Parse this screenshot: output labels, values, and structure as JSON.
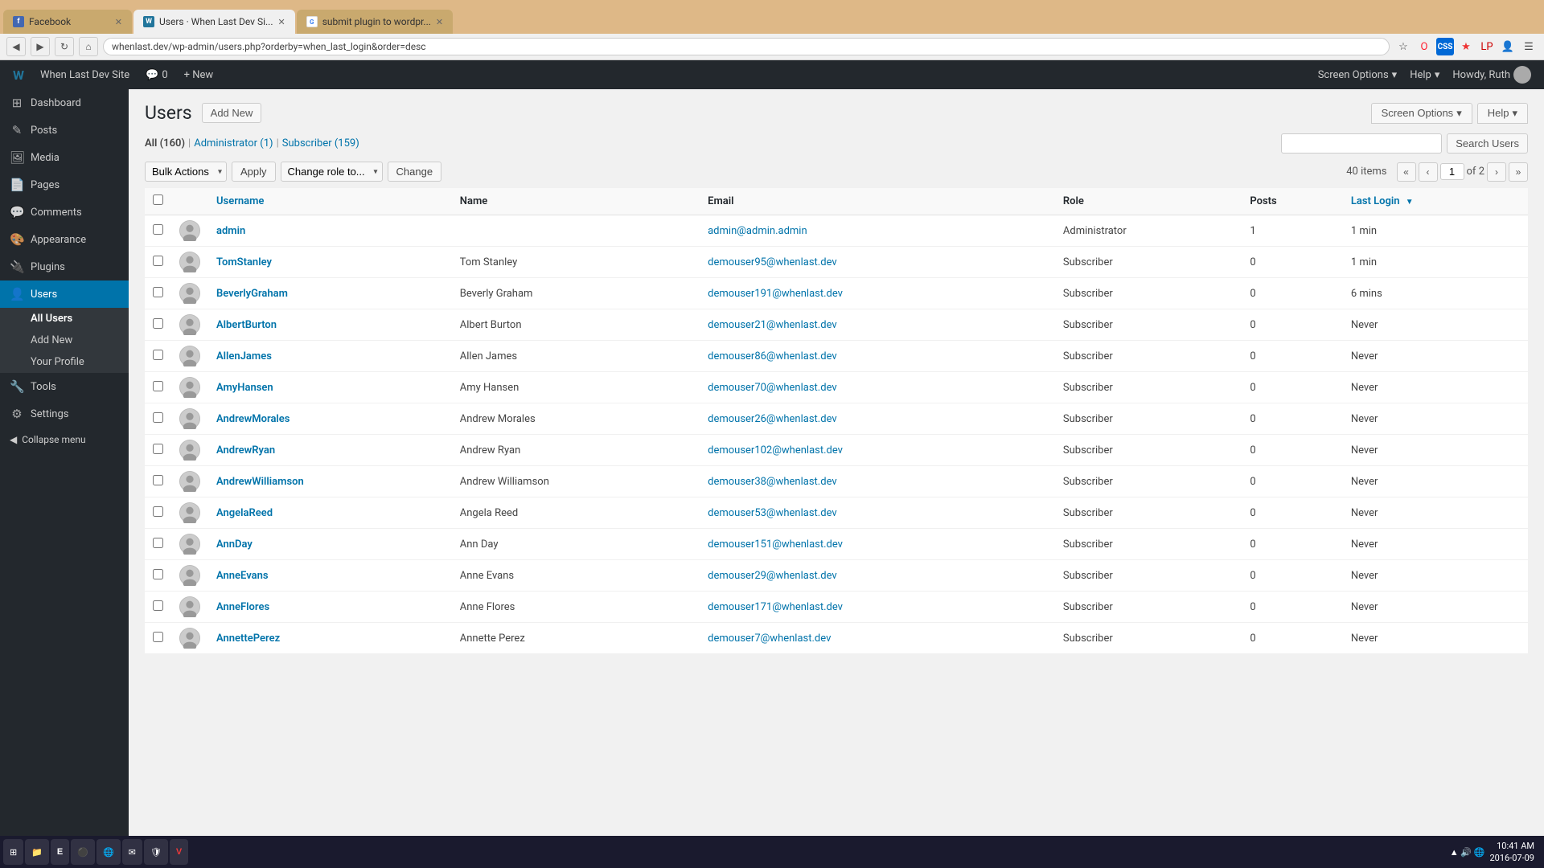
{
  "browser": {
    "tabs": [
      {
        "id": "tab-facebook",
        "label": "Facebook",
        "favicon_type": "fb",
        "active": false
      },
      {
        "id": "tab-users",
        "label": "Users · When Last Dev Si...",
        "favicon_type": "wp",
        "active": true
      },
      {
        "id": "tab-submit",
        "label": "submit plugin to wordpr...",
        "favicon_type": "google",
        "active": false
      }
    ],
    "address": "whenlast.dev/wp-admin/users.php?orderby=when_last_login&order=desc",
    "nav": {
      "back": "◀",
      "forward": "▶",
      "refresh": "↻",
      "home": "⌂"
    }
  },
  "admin_bar": {
    "wp_logo": "W",
    "site_name": "When Last Dev Site",
    "comments_icon": "💬",
    "comments_count": "0",
    "new_label": "+ New",
    "user_greeting": "Howdy, Ruth",
    "help_label": "Help",
    "screen_options_label": "Screen Options"
  },
  "sidebar": {
    "items": [
      {
        "id": "dashboard",
        "label": "Dashboard",
        "icon": "⊞"
      },
      {
        "id": "posts",
        "label": "Posts",
        "icon": "✎"
      },
      {
        "id": "media",
        "label": "Media",
        "icon": "🖼"
      },
      {
        "id": "pages",
        "label": "Pages",
        "icon": "📄"
      },
      {
        "id": "comments",
        "label": "Comments",
        "icon": "💬"
      },
      {
        "id": "appearance",
        "label": "Appearance",
        "icon": "🎨"
      },
      {
        "id": "plugins",
        "label": "Plugins",
        "icon": "🔌"
      },
      {
        "id": "users",
        "label": "Users",
        "icon": "👤",
        "active": true
      },
      {
        "id": "tools",
        "label": "Tools",
        "icon": "🔧"
      },
      {
        "id": "settings",
        "label": "Settings",
        "icon": "⚙"
      }
    ],
    "submenu_users": [
      {
        "id": "all-users",
        "label": "All Users",
        "active": true
      },
      {
        "id": "add-new",
        "label": "Add New"
      },
      {
        "id": "your-profile",
        "label": "Your Profile"
      }
    ],
    "collapse_label": "Collapse menu"
  },
  "page": {
    "title": "Users",
    "add_new_label": "Add New",
    "filter_links": [
      {
        "label": "All",
        "count": 160,
        "href": "#",
        "current": true
      },
      {
        "label": "Administrator",
        "count": 1,
        "href": "#"
      },
      {
        "label": "Subscriber",
        "count": 159,
        "href": "#"
      }
    ],
    "search_placeholder": "",
    "search_btn_label": "Search Users",
    "bulk_actions_label": "Bulk Actions",
    "apply_label": "Apply",
    "change_role_label": "Change role to...",
    "change_btn_label": "Change",
    "pagination": {
      "items_count": "40 items",
      "first": "«",
      "prev": "‹",
      "current_page": "1",
      "of": "of",
      "total_pages": "2",
      "next": "›",
      "last": "»"
    },
    "table_headers": {
      "username": "Username",
      "name": "Name",
      "email": "Email",
      "role": "Role",
      "posts": "Posts",
      "last_login": "Last Login"
    },
    "users": [
      {
        "username": "admin",
        "name": "",
        "email": "admin@admin.admin",
        "role": "Administrator",
        "posts": 1,
        "last_login": "1 min"
      },
      {
        "username": "TomStanley",
        "name": "Tom Stanley",
        "email": "demouser95@whenlast.dev",
        "role": "Subscriber",
        "posts": 0,
        "last_login": "1 min"
      },
      {
        "username": "BeverlyGraham",
        "name": "Beverly Graham",
        "email": "demouser191@whenlast.dev",
        "role": "Subscriber",
        "posts": 0,
        "last_login": "6 mins"
      },
      {
        "username": "AlbertBurton",
        "name": "Albert Burton",
        "email": "demouser21@whenlast.dev",
        "role": "Subscriber",
        "posts": 0,
        "last_login": "Never"
      },
      {
        "username": "AllenJames",
        "name": "Allen James",
        "email": "demouser86@whenlast.dev",
        "role": "Subscriber",
        "posts": 0,
        "last_login": "Never"
      },
      {
        "username": "AmyHansen",
        "name": "Amy Hansen",
        "email": "demouser70@whenlast.dev",
        "role": "Subscriber",
        "posts": 0,
        "last_login": "Never"
      },
      {
        "username": "AndrewMorales",
        "name": "Andrew Morales",
        "email": "demouser26@whenlast.dev",
        "role": "Subscriber",
        "posts": 0,
        "last_login": "Never"
      },
      {
        "username": "AndrewRyan",
        "name": "Andrew Ryan",
        "email": "demouser102@whenlast.dev",
        "role": "Subscriber",
        "posts": 0,
        "last_login": "Never"
      },
      {
        "username": "AndrewWilliamson",
        "name": "Andrew Williamson",
        "email": "demouser38@whenlast.dev",
        "role": "Subscriber",
        "posts": 0,
        "last_login": "Never"
      },
      {
        "username": "AngelaReed",
        "name": "Angela Reed",
        "email": "demouser53@whenlast.dev",
        "role": "Subscriber",
        "posts": 0,
        "last_login": "Never"
      },
      {
        "username": "AnnDay",
        "name": "Ann Day",
        "email": "demouser151@whenlast.dev",
        "role": "Subscriber",
        "posts": 0,
        "last_login": "Never"
      },
      {
        "username": "AnneEvans",
        "name": "Anne Evans",
        "email": "demouser29@whenlast.dev",
        "role": "Subscriber",
        "posts": 0,
        "last_login": "Never"
      },
      {
        "username": "AnneFlores",
        "name": "Anne Flores",
        "email": "demouser171@whenlast.dev",
        "role": "Subscriber",
        "posts": 0,
        "last_login": "Never"
      },
      {
        "username": "AnnettePerez",
        "name": "Annette Perez",
        "email": "demouser7@whenlast.dev",
        "role": "Subscriber",
        "posts": 0,
        "last_login": "Never"
      }
    ]
  },
  "taskbar": {
    "start_icon": "⊞",
    "apps": [
      {
        "id": "folder",
        "icon": "📁"
      },
      {
        "id": "epic",
        "icon": "E"
      },
      {
        "id": "obs",
        "icon": "⚫"
      },
      {
        "id": "chrome",
        "icon": "🌐"
      },
      {
        "id": "thunderbird",
        "icon": "✉"
      },
      {
        "id": "vpn",
        "icon": "🛡"
      },
      {
        "id": "vivaldi",
        "icon": "V"
      }
    ],
    "time": "10:41 AM",
    "date": "2016-07-09"
  }
}
